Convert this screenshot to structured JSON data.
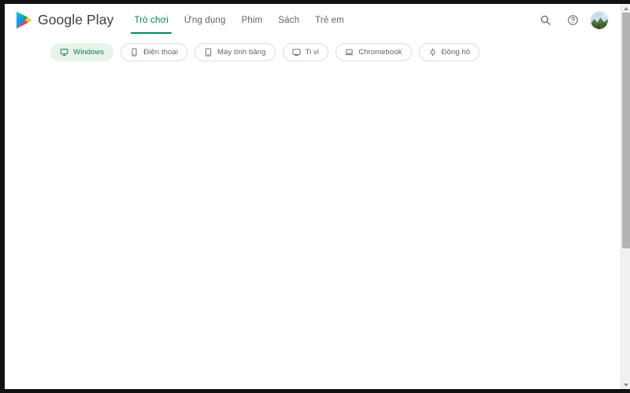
{
  "window": {
    "frame_color": "#111111",
    "page_background": "#ffffff"
  },
  "header": {
    "brand": {
      "name": "Google Play",
      "logo_icon": "google-play-triangle-icon",
      "logo_colors": {
        "blue": "#00a0ff",
        "green": "#00e676",
        "yellow": "#ffce00",
        "red": "#ff3a44"
      }
    },
    "tabs": [
      {
        "label": "Trò chơi",
        "active": true
      },
      {
        "label": "Ứng dụng",
        "active": false
      },
      {
        "label": "Phim",
        "active": false
      },
      {
        "label": "Sách",
        "active": false
      },
      {
        "label": "Trẻ em",
        "active": false
      }
    ],
    "active_tab_color": "#01875f",
    "inactive_tab_color": "#5f6368",
    "actions": [
      {
        "name": "search-icon",
        "label": "Tìm kiếm"
      },
      {
        "name": "help-icon",
        "label": "Trợ giúp"
      },
      {
        "name": "account-avatar",
        "label": "Tài khoản"
      }
    ]
  },
  "filters": {
    "chips": [
      {
        "label": "Windows",
        "icon": "desktop-icon",
        "active": true
      },
      {
        "label": "Điện thoại",
        "icon": "phone-icon",
        "active": false
      },
      {
        "label": "Máy tính bảng",
        "icon": "tablet-icon",
        "active": false
      },
      {
        "label": "Ti vi",
        "icon": "tv-icon",
        "active": false
      },
      {
        "label": "Chromebook",
        "icon": "laptop-icon",
        "active": false
      },
      {
        "label": "Đồng hồ",
        "icon": "watch-icon",
        "active": false
      }
    ],
    "active_chip_background": "#e6f4ea",
    "active_chip_text_color": "#0f7b54",
    "chip_border_color": "#dadce0",
    "chip_text_color": "#5f6368"
  },
  "main": {
    "body_text": ""
  },
  "scrollbar": {
    "orientation": "vertical",
    "up_arrow": "scroll-up-arrow-icon",
    "down_arrow": "scroll-down-arrow-icon",
    "track_color": "#f1f1f1",
    "thumb_color": "#b3b3b3"
  }
}
